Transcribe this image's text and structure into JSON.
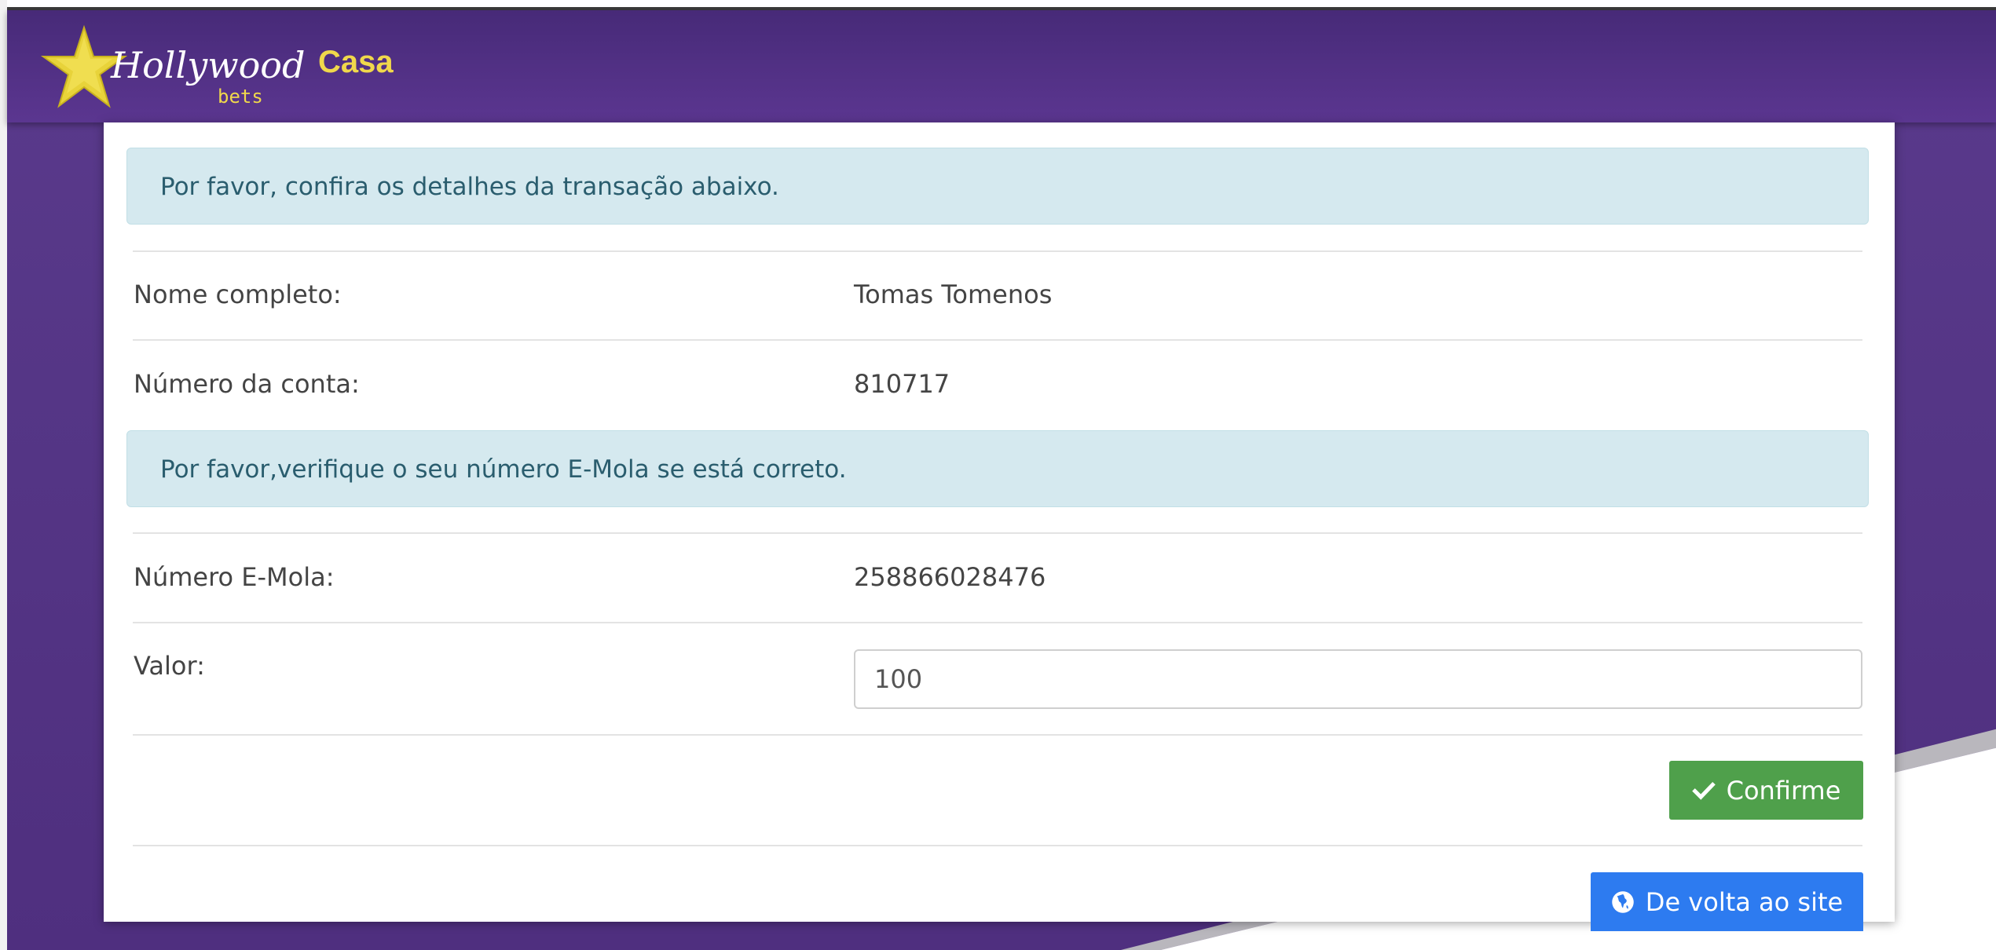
{
  "header": {
    "brand_logo_text": "Hollywood bets",
    "brand_section": "Casa"
  },
  "alerts": {
    "confirm_details": "Por favor, confira os detalhes da transação abaixo.",
    "verify_number": "Por favor,verifique o seu número E-Mola se está correto."
  },
  "details": {
    "full_name_label": "Nome completo:",
    "full_name_value": "Tomas Tomenos",
    "account_label": "Número da conta:",
    "account_value": "810717",
    "emola_label": "Número E-Mola:",
    "emola_value": "258866028476",
    "amount_label": "Valor:",
    "amount_value": "100"
  },
  "buttons": {
    "confirm_label": "Confirme",
    "confirm_icon": "check-icon",
    "back_label": "De volta ao site",
    "back_icon": "globe-icon"
  },
  "colors": {
    "header_purple": "#4f2f7f",
    "brand_yellow": "#f0d84b",
    "alert_bg": "#d5e9ef",
    "confirm_green": "#4fa04b",
    "back_blue": "#2d7bf0"
  }
}
